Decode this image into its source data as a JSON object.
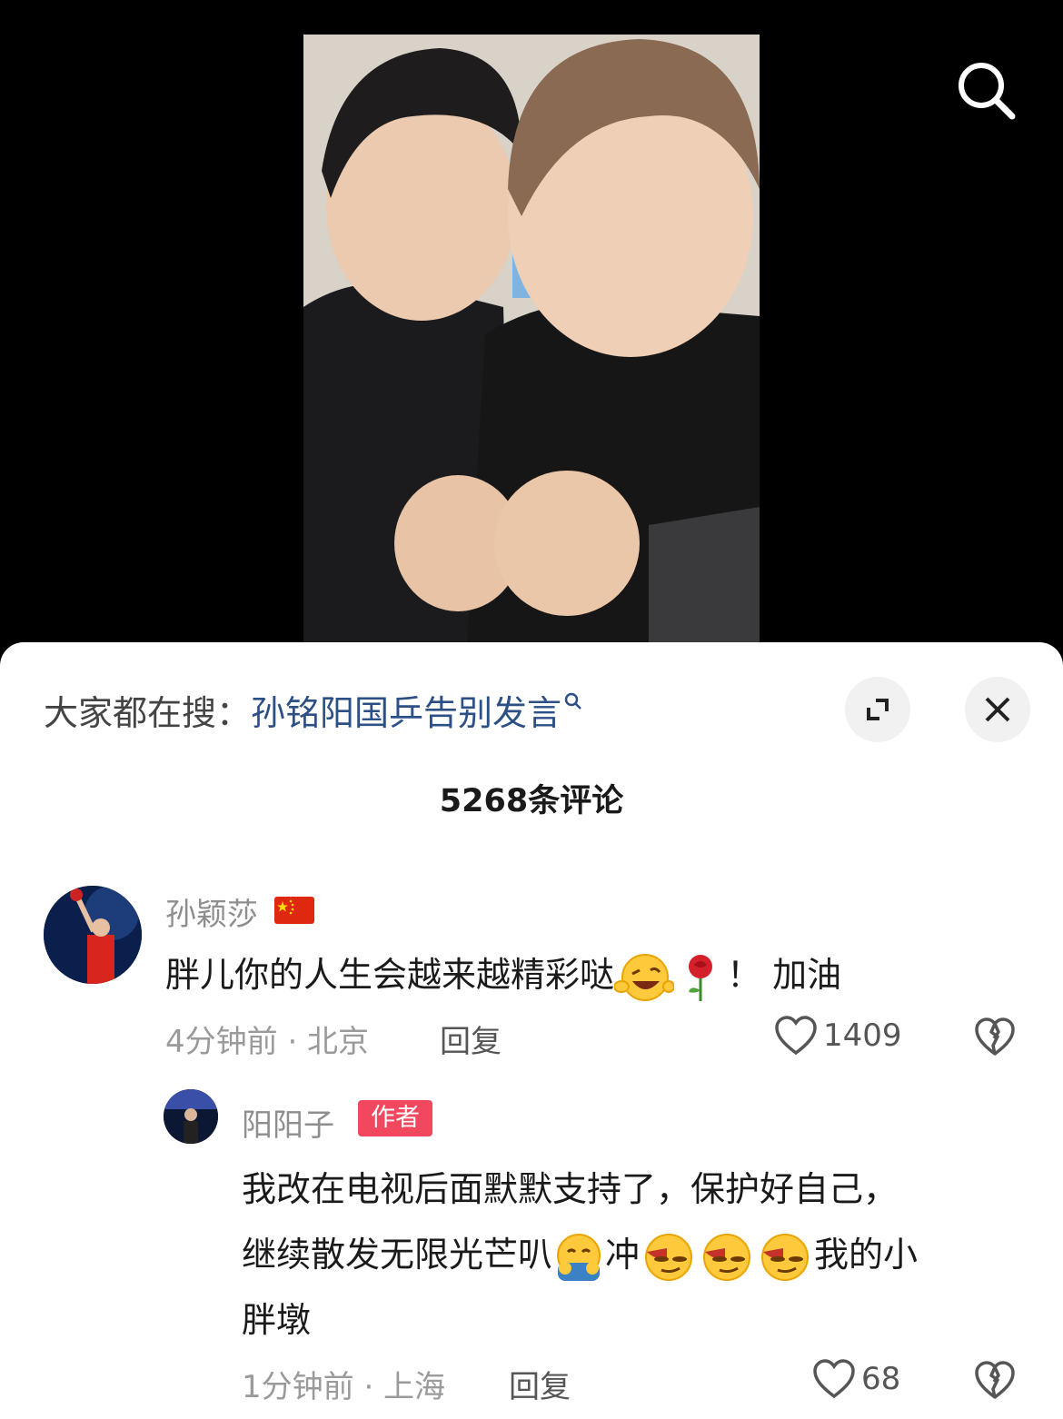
{
  "search": {
    "icon": "search-icon"
  },
  "hot_search": {
    "prefix": "大家都在搜：",
    "term": "孙铭阳国乒告别发言"
  },
  "comments_header": {
    "count_label": "5268条评论"
  },
  "comments": [
    {
      "username": "孙颖莎",
      "text_before": "胖儿你的人生会越来越精彩哒",
      "text_after": "！ 加油",
      "meta": "4分钟前 · 北京",
      "reply_label": "回复",
      "likes": "1409"
    },
    {
      "username": "阳阳子",
      "author_tag": "作者",
      "line1": "我改在电视后面默默支持了，保护好自己，",
      "line2_before": "继续散发无限光芒叭",
      "line2_mid": "冲",
      "line2_after": "我的小",
      "line3": "胖墩",
      "meta": "1分钟前 · 上海",
      "reply_label": "回复",
      "likes": "68"
    }
  ],
  "colors": {
    "link": "#2c4f86",
    "author_tag": "#f2485f",
    "muted": "#9a9a9a"
  }
}
